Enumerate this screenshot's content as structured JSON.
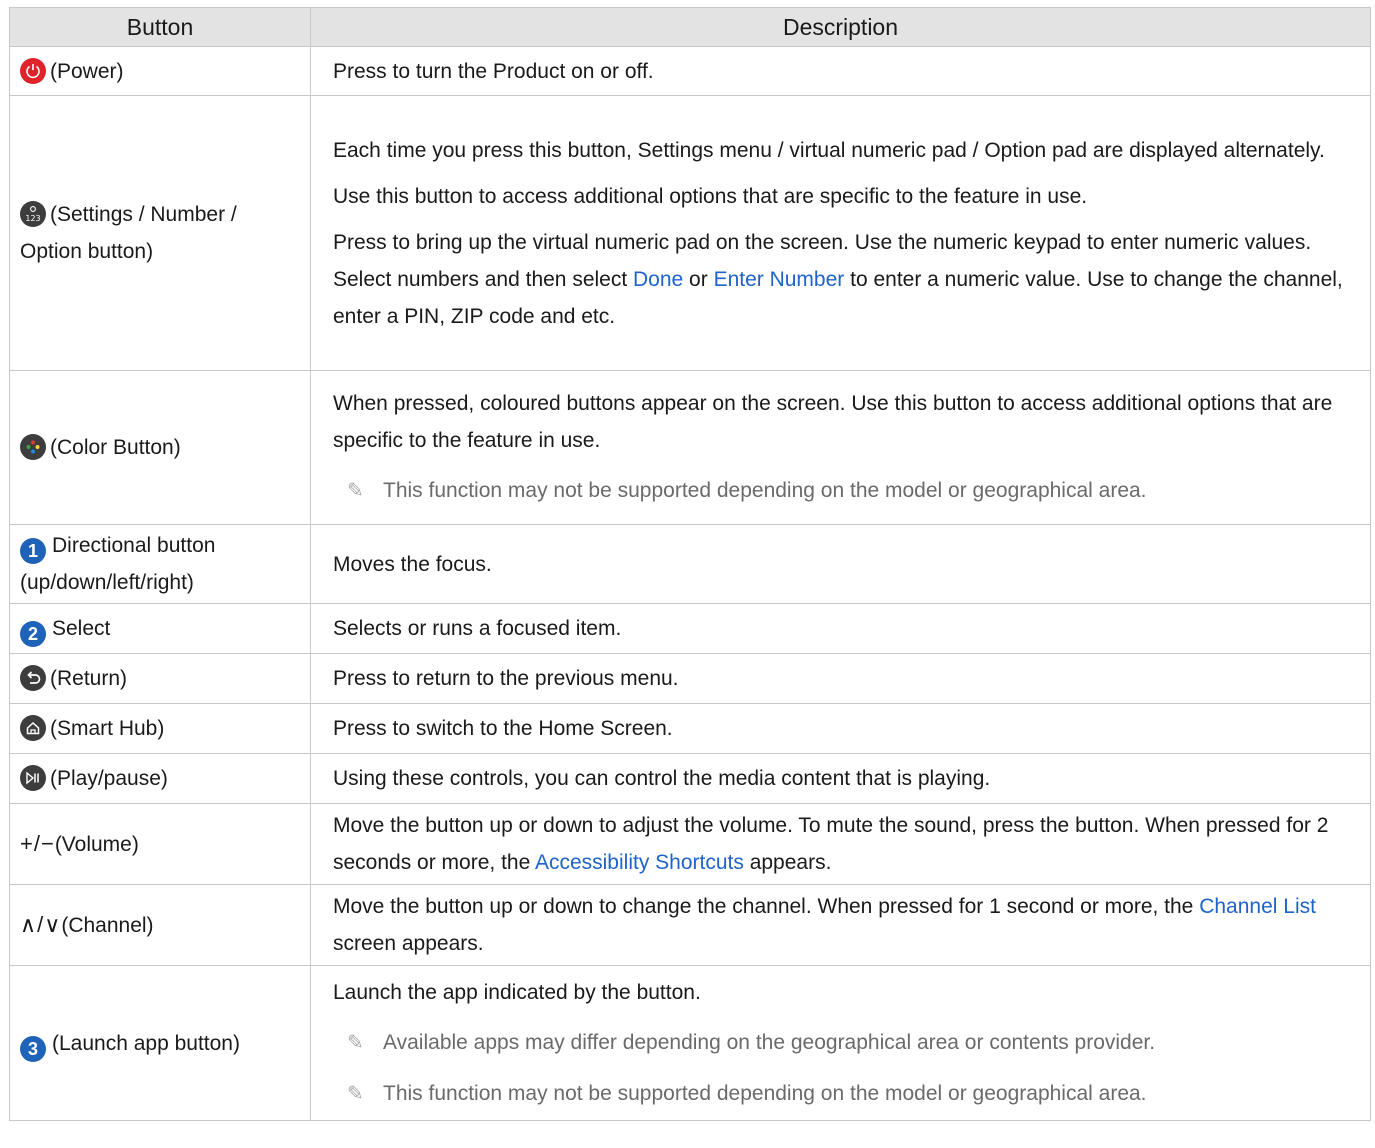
{
  "header": {
    "col_button": "Button",
    "col_description": "Description"
  },
  "rows": {
    "power": {
      "label": "(Power)",
      "desc": "Press to turn the Product on or off."
    },
    "settings": {
      "label": "(Settings / Number / Option button)",
      "desc1": "Each time you press this button, Settings menu / virtual numeric pad / Option pad are displayed alternately.",
      "desc2": "Use this button to access additional options that are specific to the feature in use.",
      "desc3_a": "Press to bring up the virtual numeric pad on the screen. Use the numeric keypad to enter numeric values. Select numbers and then select ",
      "desc3_link1": "Done",
      "desc3_b": " or ",
      "desc3_link2": "Enter Number",
      "desc3_c": " to enter a numeric value. Use to change the channel, enter a PIN, ZIP code and etc."
    },
    "color": {
      "label": "(Color Button)",
      "desc": "When pressed, coloured buttons appear on the screen. Use this button to access additional options that are specific to the feature in use.",
      "note": "This function may not be supported depending on the model or geographical area."
    },
    "directional": {
      "num": "1",
      "label": "Directional button (up/down/left/right)",
      "desc": "Moves the focus."
    },
    "select": {
      "num": "2",
      "label": "Select",
      "desc": "Selects or runs a focused item."
    },
    "return": {
      "label": "(Return)",
      "desc": "Press to return to the previous menu."
    },
    "smarthub": {
      "label": "(Smart Hub)",
      "desc": "Press to switch to the Home Screen."
    },
    "playpause": {
      "label": "(Play/pause)",
      "desc": "Using these controls, you can control the media content that is playing."
    },
    "volume": {
      "symbol": "+/−",
      "label": "(Volume)",
      "desc_a": "Move the button up or down to adjust the volume. To mute the sound, press the button. When pressed for 2 seconds or more, the ",
      "desc_link": "Accessibility Shortcuts",
      "desc_b": " appears."
    },
    "channel": {
      "symbol": "∧/∨",
      "label": "(Channel)",
      "desc_a": "Move the button up or down to change the channel. When pressed for 1 second or more, the ",
      "desc_link": "Channel List",
      "desc_b": " screen appears."
    },
    "launch": {
      "num": "3",
      "label": "(Launch app button)",
      "desc": "Launch the app indicated by the button.",
      "note1": "Available apps may differ depending on the geographical area or contents provider.",
      "note2": "This function may not be supported depending on the model or geographical area."
    }
  },
  "icons": {
    "power": "power-icon",
    "settings": "settings-number-icon",
    "color": "color-button-icon",
    "return": "return-icon",
    "smarthub": "home-icon",
    "playpause": "play-pause-icon",
    "note": "pencil-note-icon"
  },
  "colors": {
    "header_bg": "#e3e3e3",
    "link": "#1e63c9",
    "badge": "#1f63b8",
    "power": "#e0232b",
    "note_text": "#6a6a6a"
  }
}
